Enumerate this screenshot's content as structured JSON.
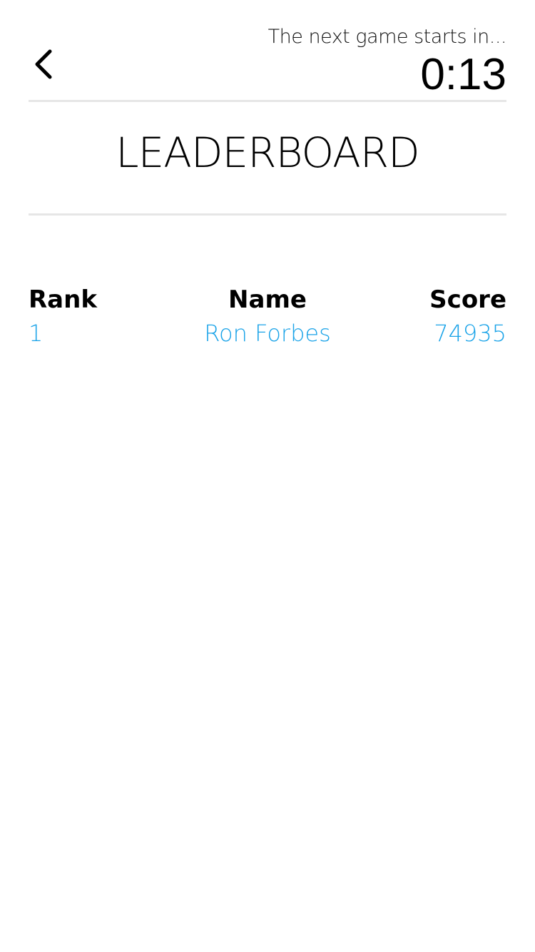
{
  "header": {
    "back_icon": "chevron-left-icon",
    "next_game_label": "The next game starts in...",
    "countdown": "0:13"
  },
  "page": {
    "title": "LEADERBOARD"
  },
  "leaderboard": {
    "columns": [
      "Rank",
      "Name",
      "Score"
    ],
    "rows": [
      {
        "rank": "1",
        "name": "Ron Forbes",
        "score": "74935"
      }
    ],
    "accent_color": "#1aa3e8"
  }
}
